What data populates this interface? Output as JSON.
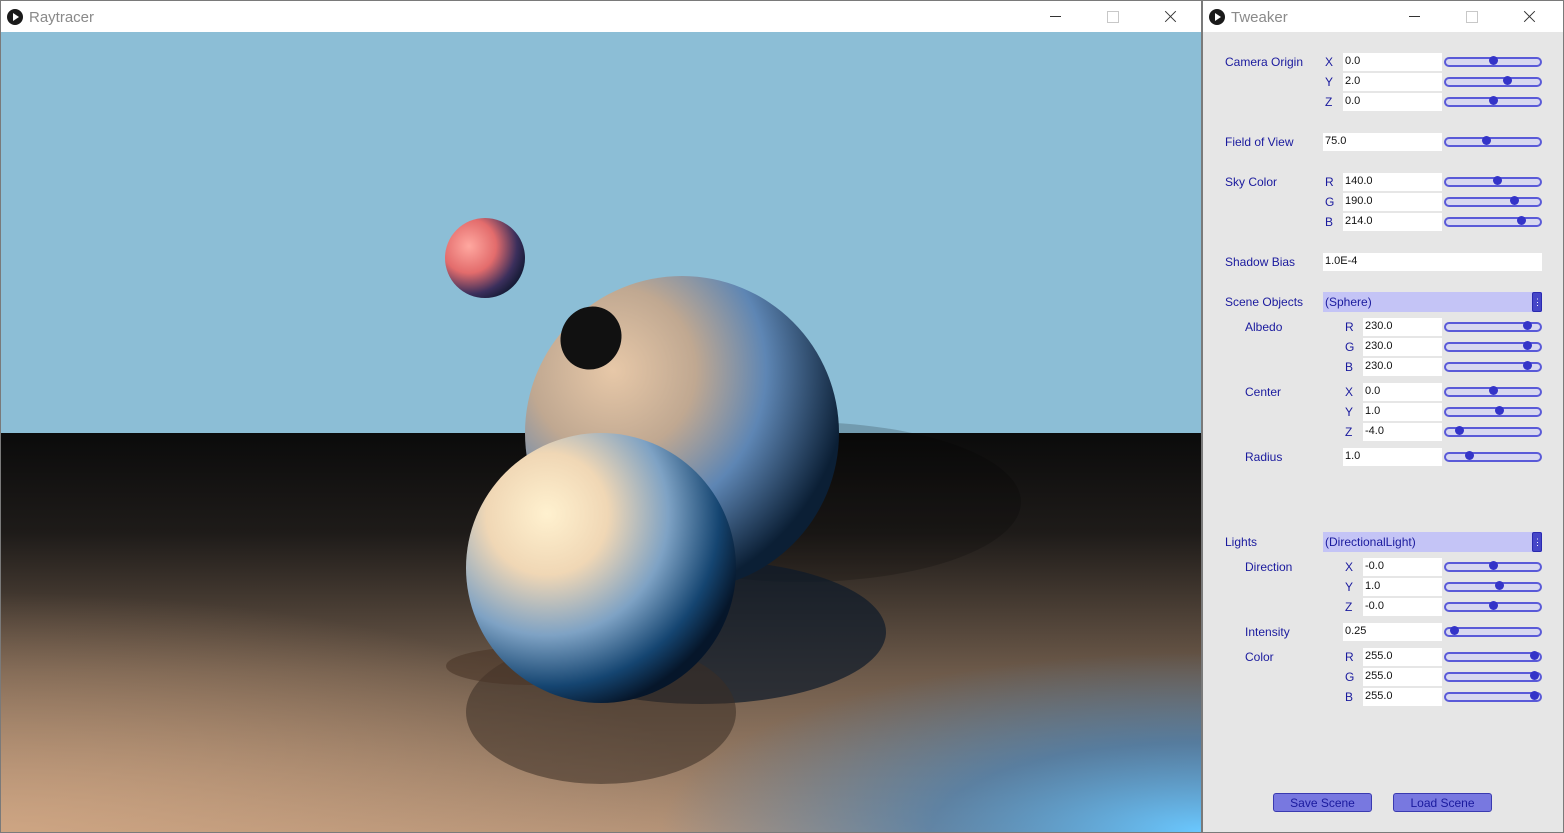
{
  "raytracer": {
    "title": "Raytracer"
  },
  "tweaker": {
    "title": "Tweaker",
    "camera_origin": {
      "label": "Camera Origin",
      "x": "0.0",
      "y": "2.0",
      "z": "0.0",
      "x_level": 0.5,
      "y_level": 0.67,
      "z_level": 0.5
    },
    "fov": {
      "label": "Field of View",
      "value": "75.0",
      "level": 0.42
    },
    "sky_color": {
      "label": "Sky Color",
      "r": "140.0",
      "g": "190.0",
      "b": "214.0",
      "r_level": 0.55,
      "g_level": 0.75,
      "b_level": 0.84
    },
    "shadow_bias": {
      "label": "Shadow Bias",
      "value": "1.0E-4"
    },
    "scene_objects": {
      "label": "Scene Objects",
      "selected": "(Sphere)",
      "albedo": {
        "label": "Albedo",
        "r": "230.0",
        "g": "230.0",
        "b": "230.0",
        "r_level": 0.9,
        "g_level": 0.9,
        "b_level": 0.9
      },
      "center": {
        "label": "Center",
        "x": "0.0",
        "y": "1.0",
        "z": "-4.0",
        "x_level": 0.5,
        "y_level": 0.58,
        "z_level": 0.1
      },
      "radius": {
        "label": "Radius",
        "value": "1.0",
        "level": 0.22
      }
    },
    "lights": {
      "label": "Lights",
      "selected": "(DirectionalLight)",
      "direction": {
        "label": "Direction",
        "x": "-0.0",
        "y": "1.0",
        "z": "-0.0",
        "x_level": 0.5,
        "y_level": 0.58,
        "z_level": 0.5
      },
      "intensity": {
        "label": "Intensity",
        "value": "0.25",
        "level": 0.05
      },
      "color": {
        "label": "Color",
        "r": "255.0",
        "g": "255.0",
        "b": "255.0",
        "r_level": 0.99,
        "g_level": 0.99,
        "b_level": 0.99
      }
    },
    "save_label": "Save Scene",
    "load_label": "Load Scene",
    "axis": {
      "x": "X",
      "y": "Y",
      "z": "Z",
      "r": "R",
      "g": "G",
      "b": "B"
    }
  },
  "colors": {
    "sky": "#8cbed6",
    "accent": "#3434c8",
    "label": "#1a1a9e"
  }
}
